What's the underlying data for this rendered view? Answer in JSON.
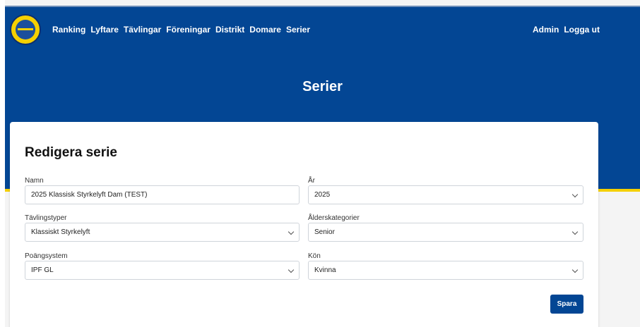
{
  "nav": {
    "items": [
      "Ranking",
      "Lyftare",
      "Tävlingar",
      "Föreningar",
      "Distrikt",
      "Domare",
      "Serier"
    ]
  },
  "user_nav": {
    "admin": "Admin",
    "logout": "Logga ut"
  },
  "page": {
    "title": "Serier"
  },
  "form": {
    "title": "Redigera serie",
    "name": {
      "label": "Namn",
      "value": "2025 Klassisk Styrkelyft Dam (TEST)"
    },
    "year": {
      "label": "År",
      "value": "2025"
    },
    "competition_types": {
      "label": "Tävlingstyper",
      "value": "Klassiskt Styrkelyft"
    },
    "age_categories": {
      "label": "Ålderskategorier",
      "value": "Senior"
    },
    "points_system": {
      "label": "Poängsystem",
      "value": "IPF GL"
    },
    "gender": {
      "label": "Kön",
      "value": "Kvinna"
    },
    "save_label": "Spara"
  },
  "colors": {
    "brand_blue": "#034694",
    "accent_yellow": "#f5d000",
    "background": "#f4f4f4"
  },
  "icons": {
    "logo": "federation-logo-icon",
    "select": "chevron-down-icon"
  }
}
